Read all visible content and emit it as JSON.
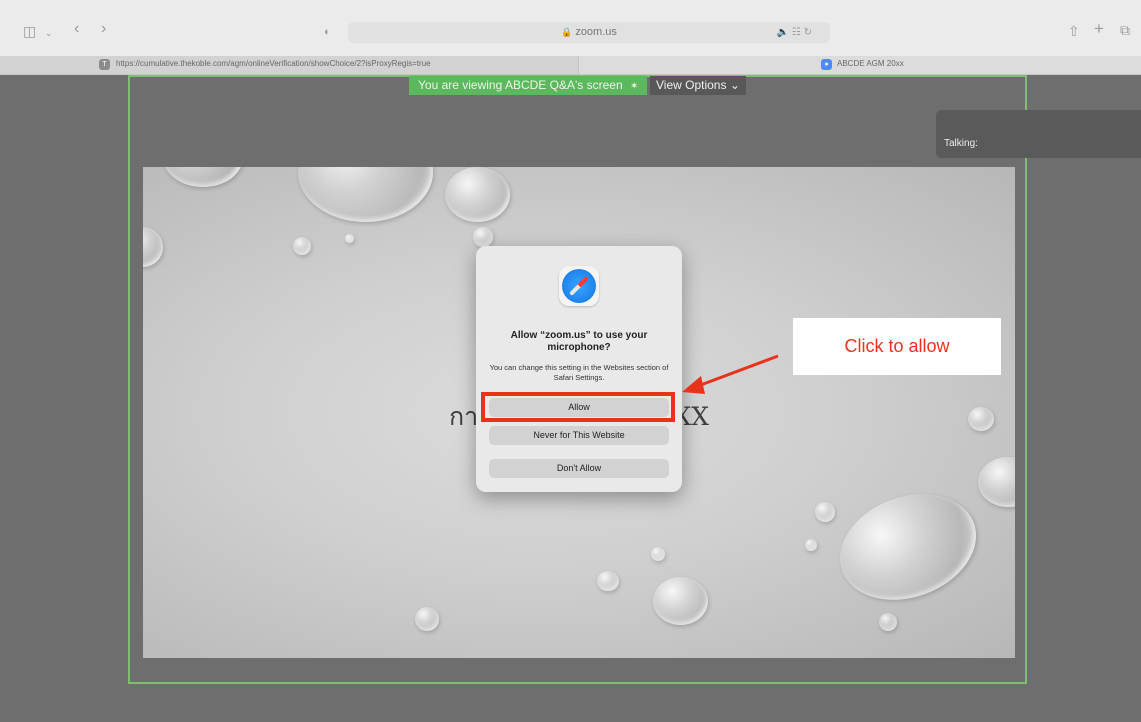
{
  "browser": {
    "address_text": "zoom.us",
    "tabs": [
      {
        "label": "https://cumulative.thekoble.com/agm/onlineVerification/showChoice/2?isProxyRegis=true",
        "favicon": "T"
      },
      {
        "label": "ABCDE AGM 20xx"
      }
    ]
  },
  "zoom": {
    "banner_text": "You are viewing ABCDE Q&A's screen",
    "view_options_label": "View Options ⌄",
    "talking_label": "Talking:"
  },
  "slide": {
    "title": "การประชุม                                      ะจำปี 25XX"
  },
  "dialog": {
    "title": "Allow “zoom.us” to use your microphone?",
    "message": "You can change this setting in the Websites section of Safari Settings.",
    "allow_label": "Allow",
    "never_label": "Never for This Website",
    "dont_allow_label": "Don't Allow"
  },
  "annotation": {
    "callout_text": "Click to allow",
    "color": "#e8331b"
  },
  "colors": {
    "share_border": "#7fc070",
    "banner": "#5cb85c"
  }
}
